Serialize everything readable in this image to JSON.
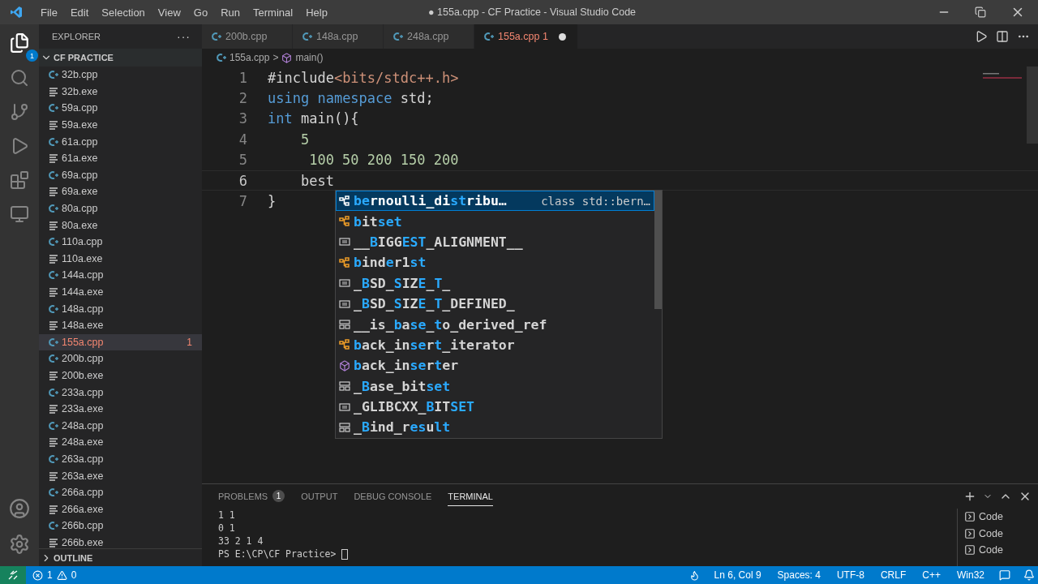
{
  "window": {
    "title": "● 155a.cpp - CF Practice - Visual Studio Code"
  },
  "menu": [
    "File",
    "Edit",
    "Selection",
    "View",
    "Go",
    "Run",
    "Terminal",
    "Help"
  ],
  "activity_bar": {
    "explorer_badge": "1"
  },
  "sidebar": {
    "title": "EXPLORER",
    "actions": "···",
    "folder": "CF PRACTICE",
    "outline": "OUTLINE",
    "files": [
      {
        "name": "32b.cpp",
        "kind": "cpp",
        "selected": false
      },
      {
        "name": "32b.exe",
        "kind": "exe",
        "selected": false
      },
      {
        "name": "59a.cpp",
        "kind": "cpp",
        "selected": false
      },
      {
        "name": "59a.exe",
        "kind": "exe",
        "selected": false
      },
      {
        "name": "61a.cpp",
        "kind": "cpp",
        "selected": false
      },
      {
        "name": "61a.exe",
        "kind": "exe",
        "selected": false
      },
      {
        "name": "69a.cpp",
        "kind": "cpp",
        "selected": false
      },
      {
        "name": "69a.exe",
        "kind": "exe",
        "selected": false
      },
      {
        "name": "80a.cpp",
        "kind": "cpp",
        "selected": false
      },
      {
        "name": "80a.exe",
        "kind": "exe",
        "selected": false
      },
      {
        "name": "110a.cpp",
        "kind": "cpp",
        "selected": false
      },
      {
        "name": "110a.exe",
        "kind": "exe",
        "selected": false
      },
      {
        "name": "144a.cpp",
        "kind": "cpp",
        "selected": false
      },
      {
        "name": "144a.exe",
        "kind": "exe",
        "selected": false
      },
      {
        "name": "148a.cpp",
        "kind": "cpp",
        "selected": false
      },
      {
        "name": "148a.exe",
        "kind": "exe",
        "selected": false
      },
      {
        "name": "155a.cpp",
        "kind": "cpp",
        "selected": true,
        "errors": "1"
      },
      {
        "name": "200b.cpp",
        "kind": "cpp",
        "selected": false
      },
      {
        "name": "200b.exe",
        "kind": "exe",
        "selected": false
      },
      {
        "name": "233a.cpp",
        "kind": "cpp",
        "selected": false
      },
      {
        "name": "233a.exe",
        "kind": "exe",
        "selected": false
      },
      {
        "name": "248a.cpp",
        "kind": "cpp",
        "selected": false
      },
      {
        "name": "248a.exe",
        "kind": "exe",
        "selected": false
      },
      {
        "name": "263a.cpp",
        "kind": "cpp",
        "selected": false
      },
      {
        "name": "263a.exe",
        "kind": "exe",
        "selected": false
      },
      {
        "name": "266a.cpp",
        "kind": "cpp",
        "selected": false
      },
      {
        "name": "266a.exe",
        "kind": "exe",
        "selected": false
      },
      {
        "name": "266b.cpp",
        "kind": "cpp",
        "selected": false
      },
      {
        "name": "266b.exe",
        "kind": "exe",
        "selected": false
      }
    ]
  },
  "tabs": [
    {
      "label": "200b.cpp",
      "selected": false,
      "dirty": false
    },
    {
      "label": "148a.cpp",
      "selected": false,
      "dirty": false
    },
    {
      "label": "248a.cpp",
      "selected": false,
      "dirty": false
    },
    {
      "label": "155a.cpp",
      "selected": true,
      "errors": "1",
      "dirty": true
    }
  ],
  "breadcrumb": {
    "file": "155a.cpp",
    "sep": ">",
    "symbol": "main()"
  },
  "code": [
    {
      "n": "1",
      "current": false,
      "tokens": [
        {
          "text": "#include",
          "kind": "plain"
        },
        {
          "text": "<bits/stdc++.h>",
          "kind": "string"
        }
      ]
    },
    {
      "n": "2",
      "current": false,
      "tokens": [
        {
          "text": "using",
          "kind": "keyword"
        },
        {
          "text": " namespace",
          "kind": "keyword"
        },
        {
          "text": " std;",
          "kind": "plain"
        }
      ]
    },
    {
      "n": "3",
      "current": false,
      "tokens": [
        {
          "text": "int",
          "kind": "keyword"
        },
        {
          "text": " main(){",
          "kind": "plain"
        }
      ]
    },
    {
      "n": "4",
      "current": false,
      "tokens": [
        {
          "text": "    5",
          "kind": "number"
        }
      ]
    },
    {
      "n": "5",
      "current": false,
      "tokens": [
        {
          "text": "     100 50 200 150 200",
          "kind": "number"
        }
      ]
    },
    {
      "n": "6",
      "current": true,
      "tokens": [
        {
          "text": "    best",
          "kind": "plain"
        }
      ]
    },
    {
      "n": "7",
      "current": false,
      "tokens": [
        {
          "text": "}",
          "kind": "plain"
        }
      ]
    }
  ],
  "suggestions": [
    {
      "kind": "class",
      "selected": true,
      "detail": "class std::bern…",
      "parts": [
        {
          "text": "be",
          "match": true
        },
        {
          "text": "rnoulli_di",
          "match": false
        },
        {
          "text": "st",
          "match": true
        },
        {
          "text": "ribu…",
          "match": false
        }
      ]
    },
    {
      "kind": "class",
      "selected": false,
      "parts": [
        {
          "text": "b",
          "match": true
        },
        {
          "text": "it",
          "match": false
        },
        {
          "text": "set",
          "match": true
        }
      ]
    },
    {
      "kind": "constant",
      "selected": false,
      "parts": [
        {
          "text": "__",
          "match": false
        },
        {
          "text": "B",
          "match": true
        },
        {
          "text": "IGG",
          "match": false
        },
        {
          "text": "EST",
          "match": true
        },
        {
          "text": "_ALIGNMENT__",
          "match": false
        }
      ]
    },
    {
      "kind": "class",
      "selected": false,
      "parts": [
        {
          "text": "b",
          "match": true
        },
        {
          "text": "ind",
          "match": false
        },
        {
          "text": "e",
          "match": true
        },
        {
          "text": "r1",
          "match": false
        },
        {
          "text": "st",
          "match": true
        }
      ]
    },
    {
      "kind": "constant",
      "selected": false,
      "parts": [
        {
          "text": "_",
          "match": false
        },
        {
          "text": "B",
          "match": true
        },
        {
          "text": "SD_",
          "match": false
        },
        {
          "text": "S",
          "match": true
        },
        {
          "text": "IZ",
          "match": false
        },
        {
          "text": "E",
          "match": true
        },
        {
          "text": "_",
          "match": false
        },
        {
          "text": "T",
          "match": true
        },
        {
          "text": "_",
          "match": false
        }
      ]
    },
    {
      "kind": "constant",
      "selected": false,
      "parts": [
        {
          "text": "_",
          "match": false
        },
        {
          "text": "B",
          "match": true
        },
        {
          "text": "SD_",
          "match": false
        },
        {
          "text": "S",
          "match": true
        },
        {
          "text": "IZ",
          "match": false
        },
        {
          "text": "E",
          "match": true
        },
        {
          "text": "_",
          "match": false
        },
        {
          "text": "T",
          "match": true
        },
        {
          "text": "_DEFINED_",
          "match": false
        }
      ]
    },
    {
      "kind": "struct",
      "selected": false,
      "parts": [
        {
          "text": "__is_",
          "match": false
        },
        {
          "text": "b",
          "match": true
        },
        {
          "text": "a",
          "match": false
        },
        {
          "text": "se",
          "match": true
        },
        {
          "text": "_",
          "match": false
        },
        {
          "text": "t",
          "match": true
        },
        {
          "text": "o_derived_ref",
          "match": false
        }
      ]
    },
    {
      "kind": "class",
      "selected": false,
      "parts": [
        {
          "text": "b",
          "match": true
        },
        {
          "text": "ack_in",
          "match": false
        },
        {
          "text": "se",
          "match": true
        },
        {
          "text": "r",
          "match": false
        },
        {
          "text": "t",
          "match": true
        },
        {
          "text": "_iterator",
          "match": false
        }
      ]
    },
    {
      "kind": "method",
      "selected": false,
      "parts": [
        {
          "text": "b",
          "match": true
        },
        {
          "text": "ack_in",
          "match": false
        },
        {
          "text": "se",
          "match": true
        },
        {
          "text": "r",
          "match": false
        },
        {
          "text": "t",
          "match": true
        },
        {
          "text": "er",
          "match": false
        }
      ]
    },
    {
      "kind": "struct",
      "selected": false,
      "parts": [
        {
          "text": "_",
          "match": false
        },
        {
          "text": "B",
          "match": true
        },
        {
          "text": "ase_bit",
          "match": false
        },
        {
          "text": "set",
          "match": true
        }
      ]
    },
    {
      "kind": "constant",
      "selected": false,
      "parts": [
        {
          "text": "_GLIBCXX_",
          "match": false
        },
        {
          "text": "B",
          "match": true
        },
        {
          "text": "IT",
          "match": false
        },
        {
          "text": "SET",
          "match": true
        }
      ]
    },
    {
      "kind": "struct",
      "selected": false,
      "parts": [
        {
          "text": "_",
          "match": false
        },
        {
          "text": "B",
          "match": true
        },
        {
          "text": "ind_r",
          "match": false
        },
        {
          "text": "es",
          "match": true
        },
        {
          "text": "u",
          "match": false
        },
        {
          "text": "lt",
          "match": true
        }
      ]
    }
  ],
  "panel": {
    "tabs": [
      {
        "label": "PROBLEMS",
        "badge": "1",
        "selected": false
      },
      {
        "label": "OUTPUT",
        "selected": false
      },
      {
        "label": "DEBUG CONSOLE",
        "selected": false
      },
      {
        "label": "TERMINAL",
        "selected": true
      }
    ],
    "terminal": [
      "1 1",
      "0 1",
      "33 2 1 4",
      "PS E:\\CP\\CF Practice>"
    ],
    "terminals": [
      "Code",
      "Code",
      "Code"
    ]
  },
  "status_bar": {
    "errors": "1",
    "warnings": "0",
    "right": [
      "Ln 6, Col 9",
      "Spaces: 4",
      "UTF-8",
      "CRLF",
      "C++",
      "Win32"
    ]
  }
}
